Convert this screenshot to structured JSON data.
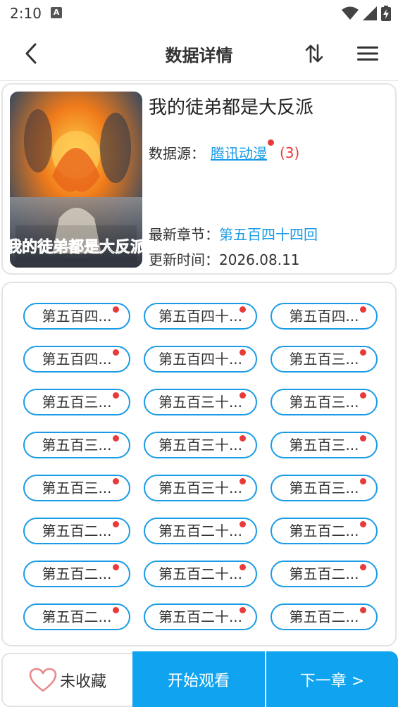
{
  "status": {
    "time": "2:10",
    "notif_icon_letter": "A",
    "icons": [
      "wifi-icon",
      "signal-icon",
      "battery-charging-icon"
    ]
  },
  "header": {
    "title": "数据详情",
    "back_icon": "chevron-left-icon",
    "sort_icon": "sort-arrows-icon",
    "menu_icon": "hamburger-menu-icon"
  },
  "book": {
    "title": "我的徒弟都是大反派",
    "source_label": "数据源：",
    "source_name": "腾讯动漫",
    "source_count": "(3)",
    "latest_label": "最新章节：",
    "latest_value": "第五百四十四回",
    "update_label": "更新时间：",
    "update_value": "2026.08.11",
    "cover_text": "我的徒弟都是大反派"
  },
  "chapters": [
    "第五百四...",
    "第五百四十...",
    "第五百四...",
    "第五百四...",
    "第五百四十...",
    "第五百三...",
    "第五百三...",
    "第五百三十...",
    "第五百三...",
    "第五百三...",
    "第五百三十...",
    "第五百三...",
    "第五百三...",
    "第五百三十...",
    "第五百三...",
    "第五百二...",
    "第五百二十...",
    "第五百二...",
    "第五百二...",
    "第五百二十...",
    "第五百二...",
    "第五百二...",
    "第五百二十...",
    "第五百二..."
  ],
  "bottom": {
    "favorite_label": "未收藏",
    "start_label": "开始观看",
    "next_label": "下一章 >"
  },
  "colors": {
    "accent": "#10a4f0",
    "link": "#1a9be6",
    "badge": "#e83a3a",
    "border": "#e3e3e3"
  }
}
